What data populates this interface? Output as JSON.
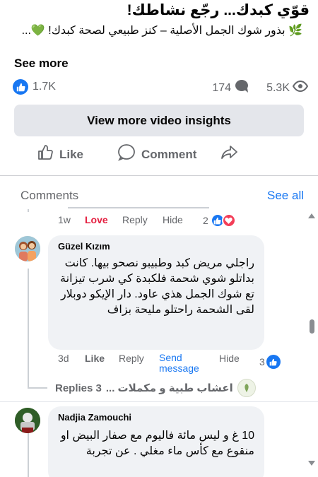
{
  "post": {
    "title": "قوّي كبدك... رجّع نشاطك!",
    "description": "🌿 بذور شوك الجمل الأصلية – كنز طبيعي لصحة كبدك! 💚...",
    "see_more": "See more"
  },
  "stats": {
    "likes": "1.7K",
    "comments": "174",
    "views": "5.3K"
  },
  "insights_button": "View more video insights",
  "actions": {
    "like": "Like",
    "comment": "Comment"
  },
  "comments_section": {
    "heading": "Comments",
    "see_all": "See all"
  },
  "prev_comment_meta": {
    "time": "1w",
    "reaction_label": "Love",
    "reply": "Reply",
    "hide": "Hide",
    "reaction_count": "2"
  },
  "comment1": {
    "author": "Güzel Kızım",
    "text": "راجلي مريض كبد وطبيبو نصحو بيها. كانت بداتلو شوي شحمة فلكبدة كي شرب تيزانة تع شوك الجمل هذي عاود. دار الإيكو دوبلار لقى الشحمة راحتلو مليحة بزاف",
    "time": "3d",
    "like": "Like",
    "reply": "Reply",
    "send_message": "Send message",
    "hide": "Hide",
    "like_count": "3"
  },
  "replies_row": {
    "label": "Replies 3",
    "page_name": "اعشاب طبية و مكملات ..."
  },
  "comment2": {
    "author": "Nadjia Zamouchi",
    "text": "10 غ و ليس مائة فاليوم مع صفار البيض او منقوع مع كأس ماء مغلي . عن تجربة"
  },
  "colors": {
    "accent": "#1877f2",
    "love": "#e41e3f",
    "secondary_text": "#65676b",
    "bubble_bg": "#f0f2f5"
  }
}
